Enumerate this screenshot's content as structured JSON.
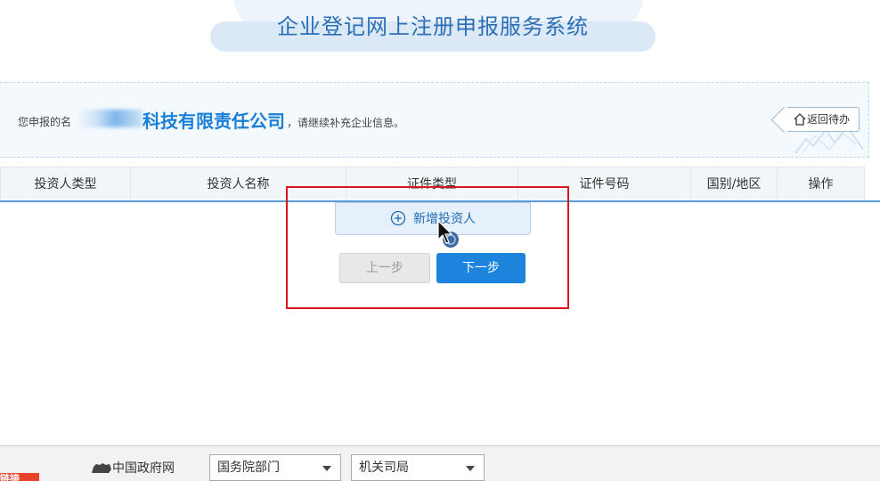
{
  "header": {
    "title": "企业登记网上注册申报服务系统"
  },
  "info": {
    "prefix": "您申报的名",
    "company_name": "科技有限责任公司",
    "suffix": "，请继续补充企业信息。",
    "back_label": "返回待办"
  },
  "table": {
    "columns": [
      "投资人类型",
      "投资人名称",
      "证件类型",
      "证件号码",
      "国别/地区",
      "操作"
    ]
  },
  "actions": {
    "add_investor": "新增投资人",
    "prev": "上一步",
    "next": "下一步"
  },
  "footer": {
    "badge": "链接",
    "gov_link": "中国政府网",
    "dropdown1": "国务院部门",
    "dropdown2": "机关司局"
  },
  "colors": {
    "brand_blue": "#1c84dc",
    "title_blue": "#2b6fb8",
    "highlight_red": "#d9161c"
  },
  "icons": [
    "home-icon",
    "plus-circle-icon",
    "mouse-cursor-icon",
    "gov-logo-icon",
    "chevron-down-icon"
  ]
}
